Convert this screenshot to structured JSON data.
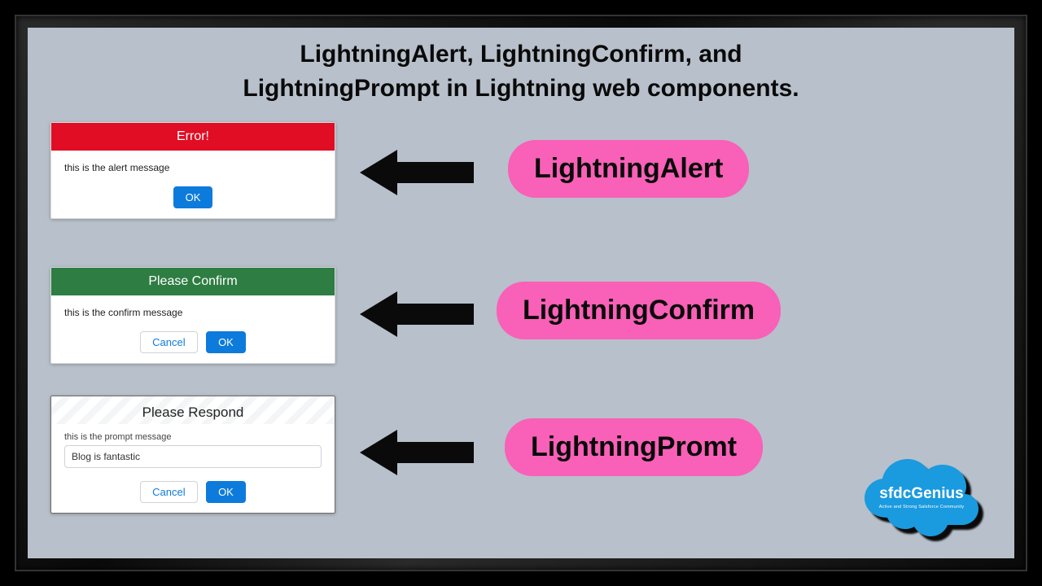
{
  "title_line1": "LightningAlert, LightningConfirm, and",
  "title_line2": "LightningPrompt in Lightning web components.",
  "dialogs": {
    "alert": {
      "header": "Error!",
      "message": "this is the alert message",
      "ok": "OK"
    },
    "confirm": {
      "header": "Please Confirm",
      "message": "this is the confirm message",
      "cancel": "Cancel",
      "ok": "OK"
    },
    "prompt": {
      "header": "Please Respond",
      "sublabel": "this is the prompt message",
      "input_value": "Blog is fantastic",
      "cancel": "Cancel",
      "ok": "OK"
    }
  },
  "pills": {
    "alert": "LightningAlert",
    "confirm": "LightningConfirm",
    "prompt": "LightningPromt"
  },
  "logo": {
    "name": "sfdcGenius",
    "tagline": "Active and Strong Salsforce Community"
  }
}
